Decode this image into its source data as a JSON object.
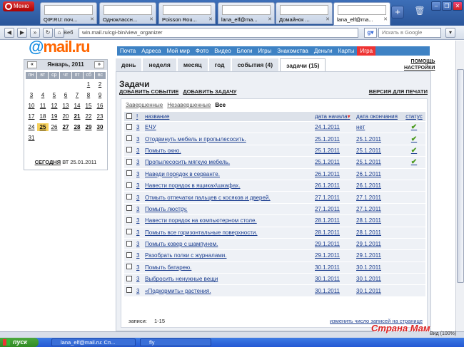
{
  "browser": {
    "menu_label": "Меню",
    "tabs": [
      {
        "label": "QIP.RU: поч..."
      },
      {
        "label": "Одноклассн..."
      },
      {
        "label": "Poisson Rou..."
      },
      {
        "label": "lana_elf@ma..."
      },
      {
        "label": "Домайнок ..."
      },
      {
        "label": "lana_elf@ma..."
      }
    ],
    "veb_label": "Веб",
    "address": "win.mail.ru/cgi-bin/view_organizer",
    "search_placeholder": "Искать в Google"
  },
  "site": {
    "logo_at": "@",
    "logo_text": "mail.ru",
    "nav": [
      "Почта",
      "Адреса",
      "Мой мир",
      "Фото",
      "Видео",
      "Блоги",
      "Игры",
      "Знакомства",
      "Деньги",
      "Карты",
      "Игра"
    ]
  },
  "calendar": {
    "month": "Январь, 2011",
    "prev": "«",
    "next": "»",
    "weekdays": [
      "пн",
      "вт",
      "ср",
      "чт",
      "пт",
      "сб",
      "вс"
    ],
    "today_label": "СЕГОДНЯ",
    "today_date": "ВТ 25.01.2011"
  },
  "views": {
    "tabs": [
      "день",
      "неделя",
      "месяц",
      "год",
      "события (4)",
      "задачи (15)"
    ],
    "help": "ПОМОЩЬ",
    "settings": "НАСТРОЙКИ"
  },
  "tasks": {
    "title": "Задачи",
    "add_event": "ДОБАВИТЬ СОБЫТИЕ",
    "add_task": "ДОБАВИТЬ ЗАДАЧУ",
    "print_version": "ВЕРСИЯ ДЛЯ ПЕЧАТИ",
    "filters": [
      "Завершенные",
      "Незавершенные",
      "Все"
    ],
    "columns": {
      "priority": "!",
      "name": "название",
      "start": "дата начала",
      "end": "дата окончания",
      "status": "статус"
    },
    "rows": [
      {
        "p": "3",
        "name": "ЕЧУ",
        "start": "24.1.2011",
        "end": "нет",
        "done": true
      },
      {
        "p": "3",
        "name": "Отодвинуть мебель и пропылесосить.",
        "start": "25.1.2011",
        "end": "25.1.2011",
        "done": true
      },
      {
        "p": "3",
        "name": "Помыть окно.",
        "start": "25.1.2011",
        "end": "25.1.2011",
        "done": true
      },
      {
        "p": "3",
        "name": "Пропылесосить мягкую мебель.",
        "start": "25.1.2011",
        "end": "25.1.2011",
        "done": true
      },
      {
        "p": "3",
        "name": "Наведи порядок в серванте.",
        "start": "26.1.2011",
        "end": "26.1.2011",
        "done": false
      },
      {
        "p": "3",
        "name": "Навести порядок в ящиках\\шкафах.",
        "start": "26.1.2011",
        "end": "26.1.2011",
        "done": false
      },
      {
        "p": "3",
        "name": "Отмыть отпечатки пальцев с косяков и дверей.",
        "start": "27.1.2011",
        "end": "27.1.2011",
        "done": false
      },
      {
        "p": "3",
        "name": "Помыть люстру.",
        "start": "27.1.2011",
        "end": "27.1.2011",
        "done": false
      },
      {
        "p": "3",
        "name": "Навести порядок на компьютерном столе.",
        "start": "28.1.2011",
        "end": "28.1.2011",
        "done": false
      },
      {
        "p": "3",
        "name": "Помыть все горизонтальные поверхности.",
        "start": "28.1.2011",
        "end": "28.1.2011",
        "done": false
      },
      {
        "p": "3",
        "name": "Помыть ковер с шампунем.",
        "start": "29.1.2011",
        "end": "29.1.2011",
        "done": false
      },
      {
        "p": "3",
        "name": "Разобрать полки с журналами.",
        "start": "29.1.2011",
        "end": "29.1.2011",
        "done": false
      },
      {
        "p": "3",
        "name": "Помыть батарею.",
        "start": "30.1.2011",
        "end": "30.1.2011",
        "done": false
      },
      {
        "p": "3",
        "name": "Выбросить ненужные вещи",
        "start": "30.1.2011",
        "end": "30.1.2011",
        "done": false
      },
      {
        "p": "3",
        "name": "«Подкормить» растения.",
        "start": "30.1.2011",
        "end": "30.1.2011",
        "done": false
      }
    ],
    "records_label": "записи:",
    "records_range": "1-15",
    "change_count": "изменить число записей на странице"
  },
  "taskbar": {
    "start": "пуск",
    "items": [
      "lana_elf@mail.ru: Сп...",
      "fly"
    ]
  },
  "status": {
    "zoom": "Вид (100%)"
  },
  "watermark": "Страна Мам",
  "colors": {
    "accent": "#3e82c4",
    "logo_orange": "#ff6600",
    "done_tick": "#4a9a1e"
  }
}
